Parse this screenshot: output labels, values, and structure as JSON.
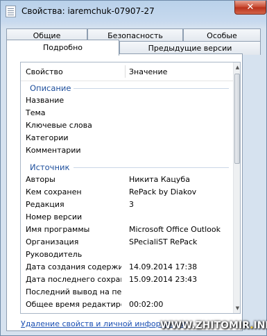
{
  "window": {
    "title": "Свойства: iaremchuk-07907-27",
    "close_label": "✕"
  },
  "tabs": {
    "row1": [
      "Общие",
      "Безопасность",
      "Особые"
    ],
    "row2": [
      "Подробно",
      "Предыдущие версии"
    ],
    "active": "Подробно"
  },
  "properties": {
    "header_property": "Свойство",
    "header_value": "Значение",
    "group_description": "Описание",
    "group_source": "Источник",
    "description_rows": [
      {
        "key": "Название",
        "value": ""
      },
      {
        "key": "Тема",
        "value": ""
      },
      {
        "key": "Ключевые слова",
        "value": ""
      },
      {
        "key": "Категории",
        "value": ""
      },
      {
        "key": "Комментарии",
        "value": ""
      }
    ],
    "source_rows": [
      {
        "key": "Авторы",
        "value": "Никита Кацуба"
      },
      {
        "key": "Кем сохранен",
        "value": "RePack by Diakov"
      },
      {
        "key": "Редакция",
        "value": "3"
      },
      {
        "key": "Номер версии",
        "value": ""
      },
      {
        "key": "Имя программы",
        "value": "Microsoft Office Outlook"
      },
      {
        "key": "Организация",
        "value": "SPecialiST RePack"
      },
      {
        "key": "Руководитель",
        "value": ""
      },
      {
        "key": "Дата создания содержи...",
        "value": "14.09.2014 17:38"
      },
      {
        "key": "Дата последнего сохран...",
        "value": "15.09.2014 23:43"
      },
      {
        "key": "Последний вывод на печ...",
        "value": ""
      },
      {
        "key": "Общее время редактиро...",
        "value": "00:02:00"
      }
    ]
  },
  "footer": {
    "remove_link": "Удаление свойств и личной информации"
  },
  "watermark": {
    "text_main": "WWW.ZHITOMIR",
    "text_dot": ".",
    "text_end": "INFO"
  }
}
